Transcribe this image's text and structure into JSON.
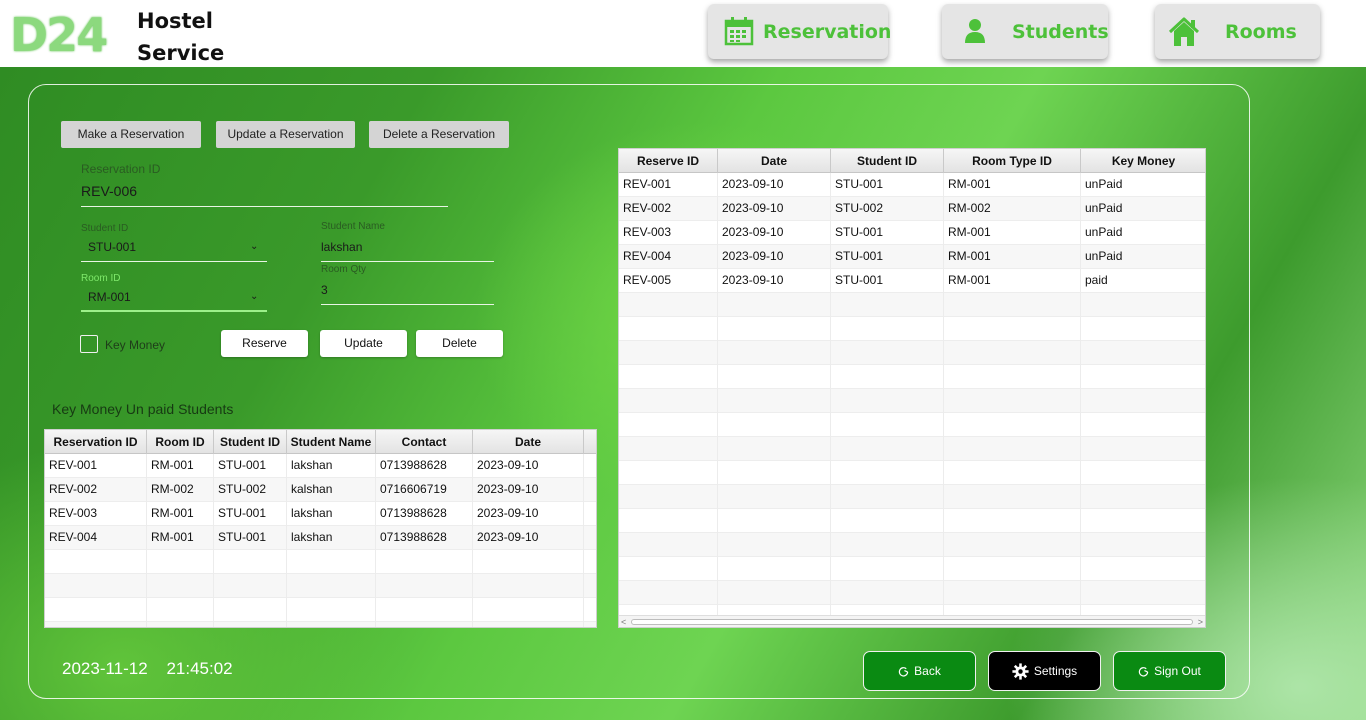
{
  "header": {
    "logo_mark": "D24",
    "logo_line1": "Hostel",
    "logo_line2": "Service",
    "nav": [
      {
        "label": "Reservation",
        "icon": "calendar-icon"
      },
      {
        "label": "Students",
        "icon": "user-icon"
      },
      {
        "label": "Rooms",
        "icon": "house-icon"
      }
    ]
  },
  "actions": {
    "make": "Make a Reservation",
    "update": "Update a Reservation",
    "delete": "Delete a Reservation"
  },
  "form": {
    "reservation_id_label": "Reservation ID",
    "reservation_id_value": "REV-006",
    "student_id_label": "Student ID",
    "student_id_value": "STU-001",
    "student_name_label": "Student Name",
    "student_name_value": "lakshan",
    "room_id_label": "Room ID",
    "room_id_value": "RM-001",
    "room_qty_label": "Room Qty",
    "room_qty_value": "3",
    "key_money_label": "Key Money",
    "reserve_btn": "Reserve",
    "update_btn": "Update",
    "delete_btn": "Delete"
  },
  "unpaid": {
    "title": "Key Money Un paid Students",
    "columns": [
      "Reservation ID",
      "Room ID",
      "Student ID",
      "Student Name",
      "Contact",
      "Date"
    ],
    "rows": [
      [
        "REV-001",
        "RM-001",
        "STU-001",
        "lakshan",
        "0713988628",
        "2023-09-10"
      ],
      [
        "REV-002",
        "RM-002",
        "STU-002",
        "kalshan",
        "0716606719",
        "2023-09-10"
      ],
      [
        "REV-003",
        "RM-001",
        "STU-001",
        "lakshan",
        "0713988628",
        "2023-09-10"
      ],
      [
        "REV-004",
        "RM-001",
        "STU-001",
        "lakshan",
        "0713988628",
        "2023-09-10"
      ]
    ]
  },
  "reservations": {
    "columns": [
      "Reserve ID",
      "Date",
      "Student ID",
      "Room Type ID",
      "Key Money"
    ],
    "rows": [
      [
        "REV-001",
        "2023-09-10",
        "STU-001",
        "RM-001",
        "unPaid"
      ],
      [
        "REV-002",
        "2023-09-10",
        "STU-002",
        "RM-002",
        "unPaid"
      ],
      [
        "REV-003",
        "2023-09-10",
        "STU-001",
        "RM-001",
        "unPaid"
      ],
      [
        "REV-004",
        "2023-09-10",
        "STU-001",
        "RM-001",
        "unPaid"
      ],
      [
        "REV-005",
        "2023-09-10",
        "STU-001",
        "RM-001",
        "paid"
      ]
    ]
  },
  "footer": {
    "date": "2023-11-12",
    "time": "21:45:02",
    "back": "Back",
    "settings": "Settings",
    "sign_out": "Sign Out"
  },
  "colors": {
    "accent_green": "#4dc13a",
    "footer_button_green": "#0a8a12"
  }
}
